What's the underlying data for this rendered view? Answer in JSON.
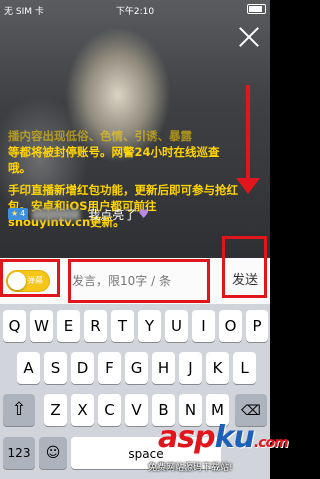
{
  "status": {
    "carrier": "无 SIM 卡",
    "time": "下午2:10"
  },
  "chat": {
    "partial_line": "播内容出现低俗、色情、引诱、暴露",
    "message1": "等都将被封停账号。网警24小时在线巡查哦。",
    "message2": "手印直播新增红包功能，更新后即可参与抢红包。安卓和iOS用户都可前往shouyintv.cn更新。",
    "level": "4",
    "user_message": "我点亮了",
    "heart": "♥"
  },
  "input_bar": {
    "toggle_label": "弹幕",
    "placeholder": "发言，限10字 / 条",
    "send_label": "发送"
  },
  "keyboard": {
    "row1": [
      "Q",
      "W",
      "E",
      "R",
      "T",
      "Y",
      "U",
      "I",
      "O",
      "P"
    ],
    "row2": [
      "A",
      "S",
      "D",
      "F",
      "G",
      "H",
      "J",
      "K",
      "L"
    ],
    "row3": [
      "Z",
      "X",
      "C",
      "V",
      "B",
      "N",
      "M"
    ],
    "numbers_label": "123",
    "space_label": "space"
  },
  "watermark": {
    "brand_red": "asp",
    "brand_blue": "ku",
    "brand_tld": ".com",
    "sub": "免费网站源码下载站!"
  },
  "colors": {
    "chat_text": "#ffd400",
    "annotation": "#e0161c",
    "toggle": "#f5c518"
  }
}
